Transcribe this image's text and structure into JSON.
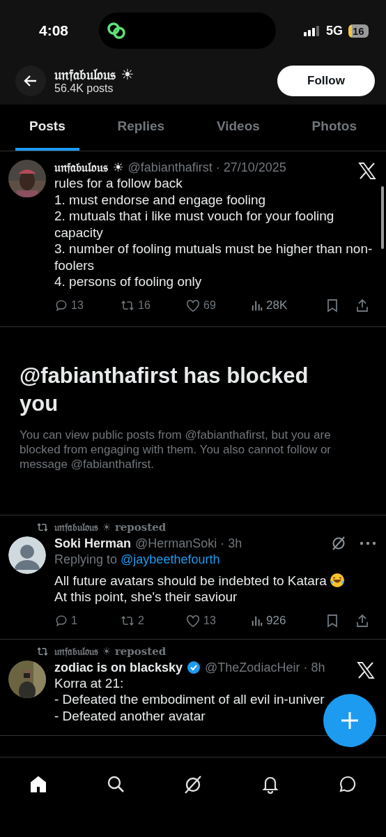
{
  "status_bar": {
    "time": "4:08",
    "network": "5G",
    "battery": "16"
  },
  "header": {
    "name": "𝔲𝔫𝔣𝔞𝔟𝔲𝔩𝔬𝔲𝔰 ☀",
    "posts_count": "56.4K posts",
    "follow_button": "Follow"
  },
  "tabs": [
    {
      "label": "Posts",
      "selected": true
    },
    {
      "label": "Replies",
      "selected": false
    },
    {
      "label": "Videos",
      "selected": false
    },
    {
      "label": "Photos",
      "selected": false
    }
  ],
  "posts": [
    {
      "kind": "pinned",
      "name": "𝔲𝔫𝔣𝔞𝔟𝔲𝔩𝔬𝔲𝔰 ☀",
      "handle": "@fabianthafirst · 27/10/2025",
      "lines": [
        "rules for a follow back",
        "1. must endorse and engage fooling",
        "2. mutuals that i like must vouch for your fooling capacity",
        "3. number of fooling mutuals must be higher than non-foolers",
        "4. persons of fooling only"
      ],
      "stats": {
        "replies": "13",
        "reposts": "16",
        "likes": "69",
        "views": "28K"
      }
    },
    {
      "kind": "blocked",
      "title": "@fabianthafirst has blocked you",
      "message": "You can view public posts from @fabianthafirst, but you are blocked from engaging with them. You also cannot follow or message @fabianthafirst."
    },
    {
      "kind": "repost",
      "reposter": "𝔲𝔫𝔣𝔞𝔟𝔲𝔩𝔬𝔲𝔰 ☀ reposted",
      "name": "Soki Herman",
      "verified": false,
      "handle": "@HermanSoki · 3h",
      "replying_label": "Replying to",
      "replying_to": "@jaybeethefourth",
      "lines": [
        "All future avatars should be indebted to Katara",
        "At this point, she's their saviour"
      ],
      "stats": {
        "replies": "1",
        "reposts": "2",
        "likes": "13",
        "views": "926"
      }
    },
    {
      "kind": "repost",
      "reposter": "𝔲𝔫𝔣𝔞𝔟𝔲𝔩𝔬𝔲𝔰 ☀ reposted",
      "name": "zodiac is on blacksky",
      "verified": true,
      "handle": "@TheZodiacHeir · 8h",
      "lines": [
        "Korra at 21:",
        "- Defeated the embodiment of all evil in-univer",
        "- Defeated another avatar"
      ]
    }
  ],
  "bottom_nav": [
    {
      "kind": "home",
      "selected": true
    },
    {
      "kind": "search",
      "selected": false
    },
    {
      "kind": "grok",
      "selected": false
    },
    {
      "kind": "notifications",
      "selected": false
    },
    {
      "kind": "messages",
      "selected": false
    }
  ]
}
